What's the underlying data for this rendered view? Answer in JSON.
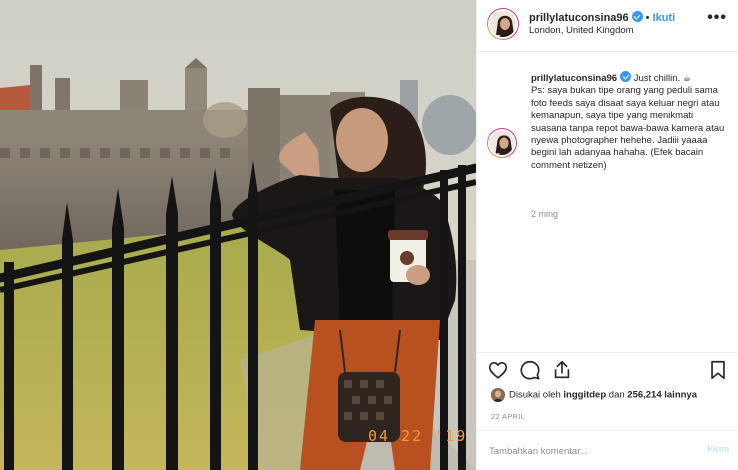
{
  "post": {
    "username": "prillylatuconsina96",
    "separator": "•",
    "follow_label": "Ikuti",
    "location": "London, United Kingdom",
    "more_label": "•••",
    "caption_text": " Just chillin. ☕\nPs: saya bukan tipe orang yang peduli sama foto feeds saya disaat saya keluar negri atau kemanapun, saya tipe yang menikmati suasana tanpa repot bawa-bawa kamera atau nyewa photographer hehehe. Jadiii yaaaa begini lah adanyaa hahaha. (Efek bacain comment netizen)",
    "caption_time": "2 ming",
    "likes_prefix": "Disukai oleh ",
    "likes_user": "inggitdep",
    "likes_middle": " dan ",
    "likes_count": "256,214 lainnya",
    "date": "22 APRIL",
    "photo_stamp": "04 22 '19"
  },
  "comment": {
    "placeholder": "Tambahkan komentar...",
    "post_label": "Kirim"
  },
  "icons": {
    "like": "heart-icon",
    "comment": "comment-icon",
    "share": "share-icon",
    "save": "bookmark-icon"
  },
  "colors": {
    "link_blue": "#3897f0",
    "muted": "#8e8e8e",
    "post_disabled": "#b2dffc"
  }
}
